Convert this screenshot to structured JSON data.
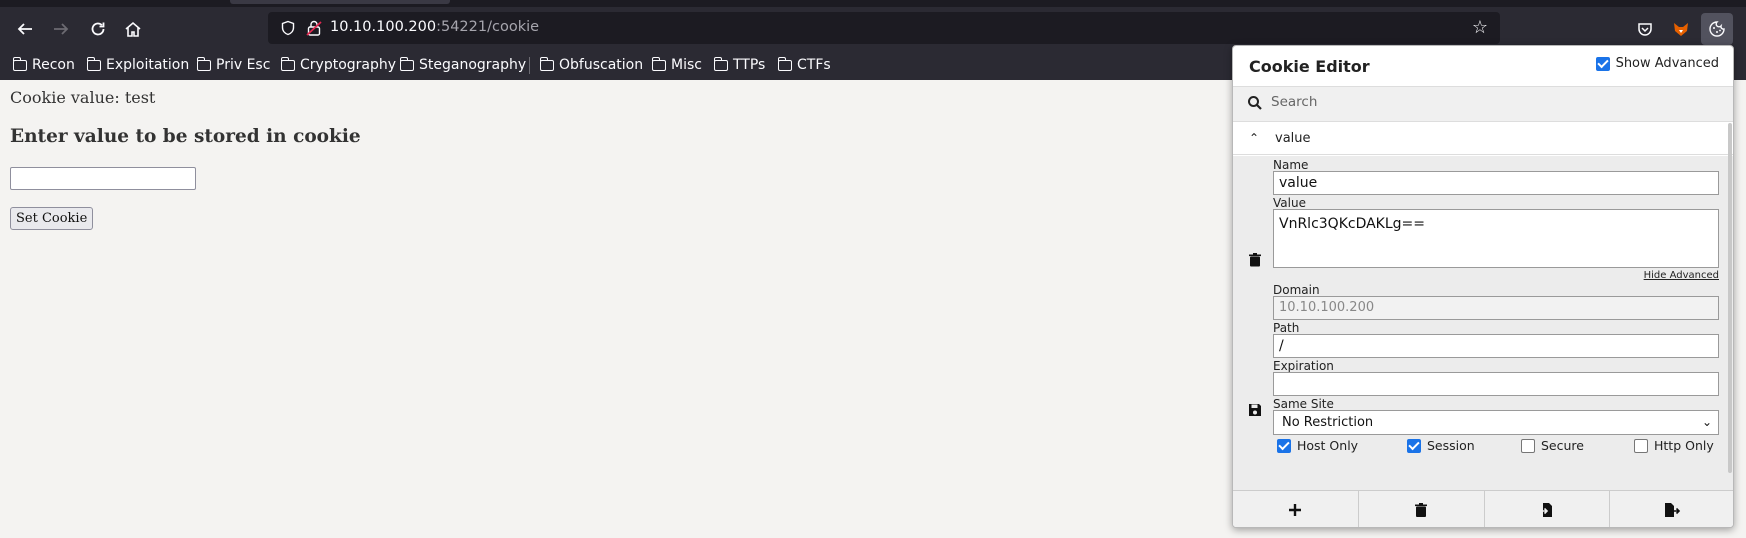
{
  "browser": {
    "url_host": "10.10.100.200",
    "url_rest": ":54221/cookie",
    "bookmarks": [
      "Recon",
      "Exploitation",
      "Priv Esc",
      "Cryptography",
      "Steganography",
      "Obfuscation",
      "Misc",
      "TTPs",
      "CTFs"
    ]
  },
  "page": {
    "cookie_value_text": "Cookie value: test",
    "heading": "Enter value to be stored in cookie",
    "input_value": "",
    "set_button": "Set Cookie"
  },
  "cookie_editor": {
    "title": "Cookie Editor",
    "show_advanced_label": "Show Advanced",
    "show_advanced_checked": true,
    "search_placeholder": "Search",
    "cookie_name_header": "value",
    "fields": {
      "name_label": "Name",
      "name_value": "value",
      "value_label": "Value",
      "value_value": "VnRlc3QKcDAKLg==",
      "hide_advanced": "Hide Advanced",
      "domain_label": "Domain",
      "domain_value": "10.10.100.200",
      "path_label": "Path",
      "path_value": "/",
      "expiration_label": "Expiration",
      "expiration_value": "",
      "same_site_label": "Same Site",
      "same_site_value": "No Restriction"
    },
    "flags": [
      {
        "label": "Host Only",
        "checked": true
      },
      {
        "label": "Session",
        "checked": true
      },
      {
        "label": "Secure",
        "checked": false
      },
      {
        "label": "Http Only",
        "checked": false
      }
    ],
    "footer_icons": [
      "add-icon",
      "delete-all-icon",
      "import-icon",
      "export-icon"
    ],
    "accent_color": "#1a73e8"
  }
}
